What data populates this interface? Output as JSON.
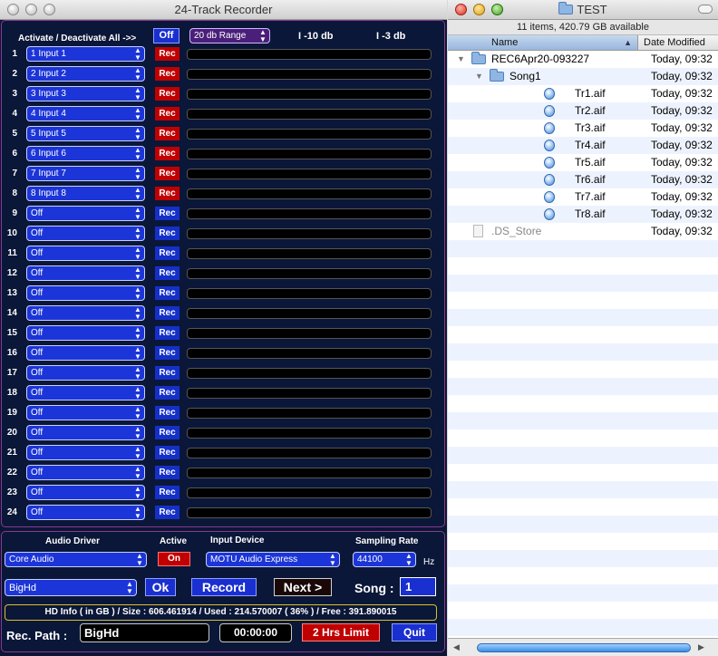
{
  "recorder": {
    "title": "24-Track Recorder",
    "header": {
      "activate_label": "Activate / Deactivate All ->>",
      "off_label": "Off",
      "range_label": "20 db Range",
      "label_10db": "I -10 db",
      "label_3db": "I -3 db"
    },
    "rec_label": "Rec",
    "tracks": [
      {
        "num": "1",
        "input": "1 Input 1",
        "armed": true
      },
      {
        "num": "2",
        "input": "2 Input 2",
        "armed": true
      },
      {
        "num": "3",
        "input": "3 Input 3",
        "armed": true
      },
      {
        "num": "4",
        "input": "4 Input 4",
        "armed": true
      },
      {
        "num": "5",
        "input": "5 Input 5",
        "armed": true
      },
      {
        "num": "6",
        "input": "6 Input 6",
        "armed": true
      },
      {
        "num": "7",
        "input": "7 Input 7",
        "armed": true
      },
      {
        "num": "8",
        "input": "8 Input 8",
        "armed": true
      },
      {
        "num": "9",
        "input": "Off",
        "armed": false
      },
      {
        "num": "10",
        "input": "Off",
        "armed": false
      },
      {
        "num": "11",
        "input": "Off",
        "armed": false
      },
      {
        "num": "12",
        "input": "Off",
        "armed": false
      },
      {
        "num": "13",
        "input": "Off",
        "armed": false
      },
      {
        "num": "14",
        "input": "Off",
        "armed": false
      },
      {
        "num": "15",
        "input": "Off",
        "armed": false
      },
      {
        "num": "16",
        "input": "Off",
        "armed": false
      },
      {
        "num": "17",
        "input": "Off",
        "armed": false
      },
      {
        "num": "18",
        "input": "Off",
        "armed": false
      },
      {
        "num": "19",
        "input": "Off",
        "armed": false
      },
      {
        "num": "20",
        "input": "Off",
        "armed": false
      },
      {
        "num": "21",
        "input": "Off",
        "armed": false
      },
      {
        "num": "22",
        "input": "Off",
        "armed": false
      },
      {
        "num": "23",
        "input": "Off",
        "armed": false
      },
      {
        "num": "24",
        "input": "Off",
        "armed": false
      }
    ],
    "bottom": {
      "audio_driver_label": "Audio Driver",
      "audio_driver_value": "Core Audio",
      "active_label": "Active",
      "active_value": "On",
      "input_device_label": "Input Device",
      "input_device_value": "MOTU Audio Express",
      "sampling_rate_label": "Sampling Rate",
      "sampling_rate_value": "44100",
      "hz_label": "Hz",
      "disk_value": "BigHd",
      "ok_label": "Ok",
      "record_label": "Record",
      "next_label": "Next >",
      "song_label": "Song :",
      "song_value": "1",
      "hd_info": "HD Info ( in GB ) / Size : 606.461914 / Used : 214.570007 ( 36% ) / Free : 391.890015",
      "rec_path_label": "Rec. Path :",
      "rec_path_value": "BigHd",
      "timer": "00:00:00",
      "limit_label": "2 Hrs Limit",
      "quit_label": "Quit"
    }
  },
  "finder": {
    "title": "TEST",
    "status": "11 items, 420.79 GB available",
    "col_name": "Name",
    "col_date": "Date Modified",
    "items": [
      {
        "name": "REC6Apr20-093227",
        "date": "Today, 09:32",
        "kind": "folder",
        "level": 0,
        "open": true
      },
      {
        "name": "Song1",
        "date": "Today, 09:32",
        "kind": "folder",
        "level": 1,
        "open": true
      },
      {
        "name": "Tr1.aif",
        "date": "Today, 09:32",
        "kind": "aif",
        "level": 2
      },
      {
        "name": "Tr2.aif",
        "date": "Today, 09:32",
        "kind": "aif",
        "level": 2
      },
      {
        "name": "Tr3.aif",
        "date": "Today, 09:32",
        "kind": "aif",
        "level": 2
      },
      {
        "name": "Tr4.aif",
        "date": "Today, 09:32",
        "kind": "aif",
        "level": 2
      },
      {
        "name": "Tr5.aif",
        "date": "Today, 09:32",
        "kind": "aif",
        "level": 2
      },
      {
        "name": "Tr6.aif",
        "date": "Today, 09:32",
        "kind": "aif",
        "level": 2
      },
      {
        "name": "Tr7.aif",
        "date": "Today, 09:32",
        "kind": "aif",
        "level": 2
      },
      {
        "name": "Tr8.aif",
        "date": "Today, 09:32",
        "kind": "aif",
        "level": 2
      },
      {
        "name": ".DS_Store",
        "date": "Today, 09:32",
        "kind": "doc",
        "level": 0,
        "dim": true
      }
    ]
  }
}
